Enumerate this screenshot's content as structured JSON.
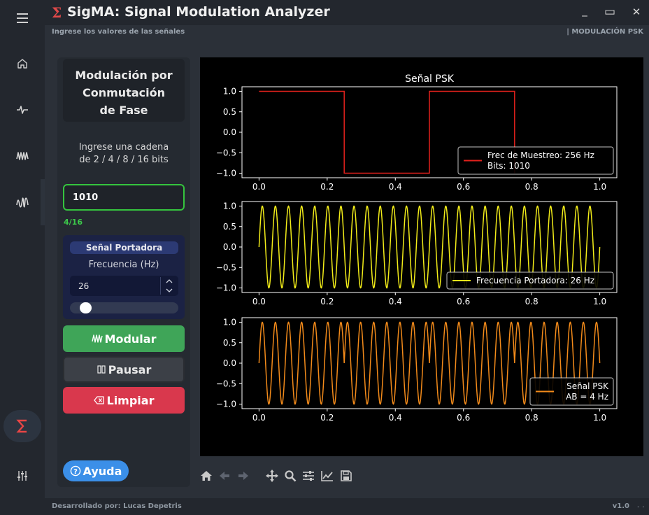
{
  "window": {
    "sigma_symbol": "Σ",
    "title": "SigMA: Signal Modulation Analyzer",
    "minimize": "_",
    "maximize": "▭",
    "close": "✕"
  },
  "header": {
    "instruction": "Ingrese los valores de las señales",
    "section": "| MODULACIÓN PSK"
  },
  "sidebar": {
    "items": [
      {
        "name": "menu",
        "icon": "hamburger-icon"
      },
      {
        "name": "home",
        "icon": "home-icon"
      },
      {
        "name": "signal",
        "icon": "pulse-wave-icon"
      },
      {
        "name": "am",
        "icon": "am-wave-icon"
      },
      {
        "name": "fm",
        "icon": "fm-wave-icon"
      },
      {
        "name": "psk",
        "icon": "sigma-icon",
        "active": true
      },
      {
        "name": "settings",
        "icon": "sliders-icon"
      }
    ]
  },
  "panel": {
    "title": [
      "Modulación por",
      "Conmutación",
      "de Fase"
    ],
    "prompt": [
      "Ingrese una cadena",
      "de 2 / 4 / 8 / 16 bits"
    ],
    "bits_value": "1010",
    "bits_counter": "4/16",
    "carrier": {
      "title": "Señal Portadora",
      "freq_label": "Frecuencia (Hz)",
      "freq_value": "26",
      "slider_fraction": 0.1
    },
    "modulate_label": "Modular",
    "pause_label": "Pausar",
    "clear_label": "Limpiar",
    "help_label": "Ayuda"
  },
  "footer": {
    "credit": "Desarrollado por: Lucas Depetris",
    "version": "v1.0"
  },
  "colors": {
    "bits_border": "#35c43e",
    "modulate": "#3fa558",
    "clear": "#d9384d",
    "help": "#3b8fe8",
    "bits_line": "#e3211c",
    "carrier_line": "#f2ec19",
    "psk_line": "#f28a1a"
  },
  "chart_data": [
    {
      "type": "line",
      "title": "Señal PSK",
      "xlim": [
        0.0,
        1.0
      ],
      "ylim": [
        -1.0,
        1.0
      ],
      "xticks": [
        "0.0",
        "0.2",
        "0.4",
        "0.6",
        "0.8",
        "1.0"
      ],
      "yticks": [
        "1.0",
        "0.5",
        "0.0",
        "−0.5",
        "−1.0"
      ],
      "legend_loc": "lower right",
      "series": [
        {
          "name": "Frec de Muestreo: 256 Hz",
          "name2": "Bits: 1010",
          "color": "#e3211c",
          "kind": "square",
          "bits": [
            1,
            0,
            1,
            0
          ],
          "x_end": 0.75,
          "levels": [
            1,
            -1,
            1,
            -1
          ]
        }
      ]
    },
    {
      "type": "line",
      "title": "",
      "xlim": [
        0.0,
        1.0
      ],
      "ylim": [
        -1.0,
        1.0
      ],
      "xticks": [
        "0.0",
        "0.2",
        "0.4",
        "0.6",
        "0.8",
        "1.0"
      ],
      "yticks": [
        "1.0",
        "0.5",
        "0.0",
        "−0.5",
        "−1.0"
      ],
      "legend_loc": "lower right",
      "series": [
        {
          "name": "Frecuencia Portadora: 26 Hz",
          "color": "#f2ec19",
          "kind": "sine",
          "frequency_hz": 26,
          "x_range": [
            0.0,
            1.0
          ]
        }
      ]
    },
    {
      "type": "line",
      "title": "",
      "xlim": [
        0.0,
        1.0
      ],
      "ylim": [
        -1.0,
        1.0
      ],
      "xticks": [
        "0.0",
        "0.2",
        "0.4",
        "0.6",
        "0.8",
        "1.0"
      ],
      "yticks": [
        "1.0",
        "0.5",
        "0.0",
        "−0.5",
        "−1.0"
      ],
      "legend_loc": "lower right",
      "series": [
        {
          "name": "Señal PSK",
          "name2": "AB = 4 Hz",
          "color": "#f28a1a",
          "kind": "psk",
          "frequency_hz": 26,
          "bits": [
            1,
            0,
            1,
            0
          ],
          "x_range": [
            0.0,
            1.0
          ]
        }
      ]
    }
  ]
}
